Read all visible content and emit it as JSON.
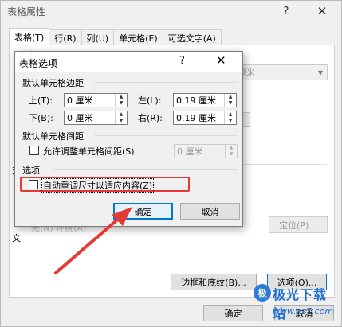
{
  "outer": {
    "title": "表格属性",
    "help": "?",
    "close": "✕",
    "tabs": [
      "表格(T)",
      "行(R)",
      "列(U)",
      "单元格(E)",
      "可选文字(A)"
    ],
    "partial_labels": [
      "尺寸",
      "寸",
      "对",
      "文"
    ],
    "bg_combo_value": "厘米",
    "bg_faint_text": "无(N)   环绕(A)",
    "buttons": {
      "position": "定位(P)...",
      "borders": "边框和底纹(B)...",
      "options": "选项(O)...",
      "ok": "确定",
      "cancel": "取消"
    }
  },
  "dialog": {
    "title": "表格选项",
    "help": "?",
    "close": "✕",
    "margins_section": "默认单元格边距",
    "top_label": "上(T):",
    "top_value": "0 厘米",
    "left_label": "左(L):",
    "left_value": "0.19 厘米",
    "bottom_label": "下(B):",
    "bottom_value": "0 厘米",
    "right_label": "右(R):",
    "right_value": "0.19 厘米",
    "spacing_section": "默认单元格间距",
    "allow_spacing_label": "允许调整单元格间距(S)",
    "spacing_value": "0 厘米",
    "options_section": "选项",
    "autofit_label": "自动重调尺寸以适应内容(Z)",
    "autofit_checked": false,
    "ok": "确定",
    "cancel": "取消"
  },
  "annotation": {
    "highlight_color": "#e53935"
  },
  "watermark": {
    "logo_text": "极",
    "name": "极光下载站",
    "url": "www.xz7.com"
  }
}
